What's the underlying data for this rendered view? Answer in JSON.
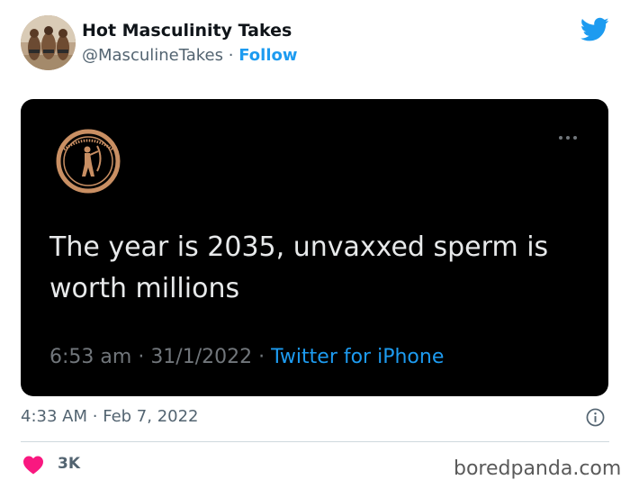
{
  "author": {
    "name": "Hot Masculinity Takes",
    "handle": "@MasculineTakes",
    "separator": "·",
    "follow_label": "Follow"
  },
  "embedded_tweet": {
    "text": "The year is 2035, unvaxxed sperm is worth millions",
    "time": "6:53 am",
    "date": "31/1/2022",
    "source": "Twitter for iPhone",
    "separator": "·"
  },
  "footer": {
    "time": "4:33 AM",
    "date": "Feb 7, 2022",
    "separator": "·",
    "likes": "3K"
  },
  "watermark": "boredpanda.com",
  "colors": {
    "accent": "#1d9bf0",
    "heart": "#f91880",
    "card_bg": "#000000",
    "text_dark": "#0f1419",
    "text_muted": "#536471"
  },
  "icons": [
    "twitter-bird-icon",
    "more-options-icon",
    "info-icon",
    "heart-icon"
  ]
}
